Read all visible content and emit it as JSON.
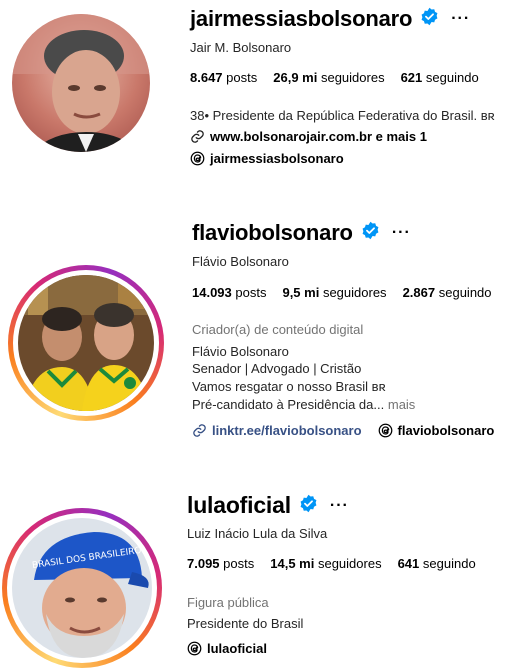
{
  "profiles": [
    {
      "username": "jairmessiasbolsonaro",
      "full_name": "Jair M. Bolsonaro",
      "posts_count": "8.647",
      "posts_label": "posts",
      "followers_count": "26,9 mi",
      "followers_label": "seguidores",
      "following_count": "621",
      "following_label": "seguindo",
      "bio_line1": "38• Presidente da República Federativa do Brasil. ʙʀ",
      "link_text": "www.bolsonarojair.com.br e mais 1",
      "threads_handle": "jairmessiasbolsonaro"
    },
    {
      "username": "flaviobolsonaro",
      "full_name": "Flávio Bolsonaro",
      "posts_count": "14.093",
      "posts_label": "posts",
      "followers_count": "9,5 mi",
      "followers_label": "seguidores",
      "following_count": "2.867",
      "following_label": "seguindo",
      "category": "Criador(a) de conteúdo digital",
      "bio_lines": [
        "Flávio Bolsonaro",
        "Senador | Advogado | Cristão",
        "Vamos resgatar o nosso Brasil ʙʀ",
        "Pré-candidato à Presidência da..."
      ],
      "bio_more": "mais",
      "link_text": "linktr.ee/flaviobolsonaro",
      "threads_handle": "flaviobolsonaro"
    },
    {
      "username": "lulaoficial",
      "full_name": "Luiz Inácio Lula da Silva",
      "posts_count": "7.095",
      "posts_label": "posts",
      "followers_count": "14,5 mi",
      "followers_label": "seguidores",
      "following_count": "641",
      "following_label": "seguindo",
      "category": "Figura pública",
      "bio_line1": "Presidente do Brasil",
      "threads_handle": "lulaoficial",
      "cap_text": "BRASIL DOS BRASILEIROS"
    }
  ],
  "colors": {
    "verified_blue": "#0095f6",
    "link_blue": "#385185",
    "muted_gray": "#737373",
    "story_ring_start": "#feda75",
    "story_ring_mid": "#fa7e1e",
    "story_ring_end": "#d62976"
  },
  "icons": [
    "verified-badge-icon",
    "more-options-icon",
    "link-icon",
    "threads-icon"
  ]
}
